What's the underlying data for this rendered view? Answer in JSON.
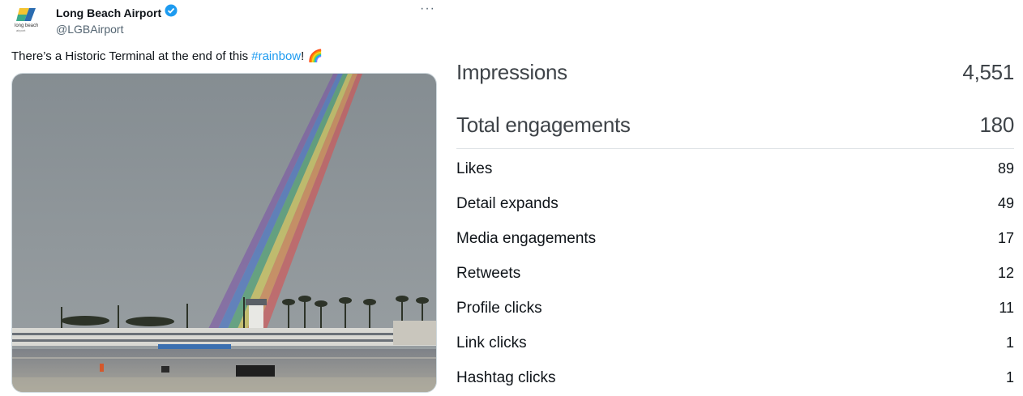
{
  "tweet": {
    "author_name": "Long Beach Airport",
    "handle": "@LGBAirport",
    "text_before": "There’s a Historic Terminal at the end of this ",
    "hashtag": "#rainbow",
    "text_after": "! 🌈",
    "more_label": "···",
    "logo_text": "long beach",
    "logo_subtext": "airport"
  },
  "stats": {
    "impressions": {
      "label": "Impressions",
      "value": "4,551"
    },
    "total_engagements": {
      "label": "Total engagements",
      "value": "180"
    },
    "items": [
      {
        "label": "Likes",
        "value": "89"
      },
      {
        "label": "Detail expands",
        "value": "49"
      },
      {
        "label": "Media engagements",
        "value": "17"
      },
      {
        "label": "Retweets",
        "value": "12"
      },
      {
        "label": "Profile clicks",
        "value": "11"
      },
      {
        "label": "Link clicks",
        "value": "1"
      },
      {
        "label": "Hashtag clicks",
        "value": "1"
      }
    ]
  },
  "colors": {
    "verified": "#1d9bf0",
    "link": "#1d9bf0",
    "sky": "#8e969b"
  },
  "icons": [
    "airport-logo-icon",
    "verified-badge-icon",
    "more-options-icon"
  ]
}
